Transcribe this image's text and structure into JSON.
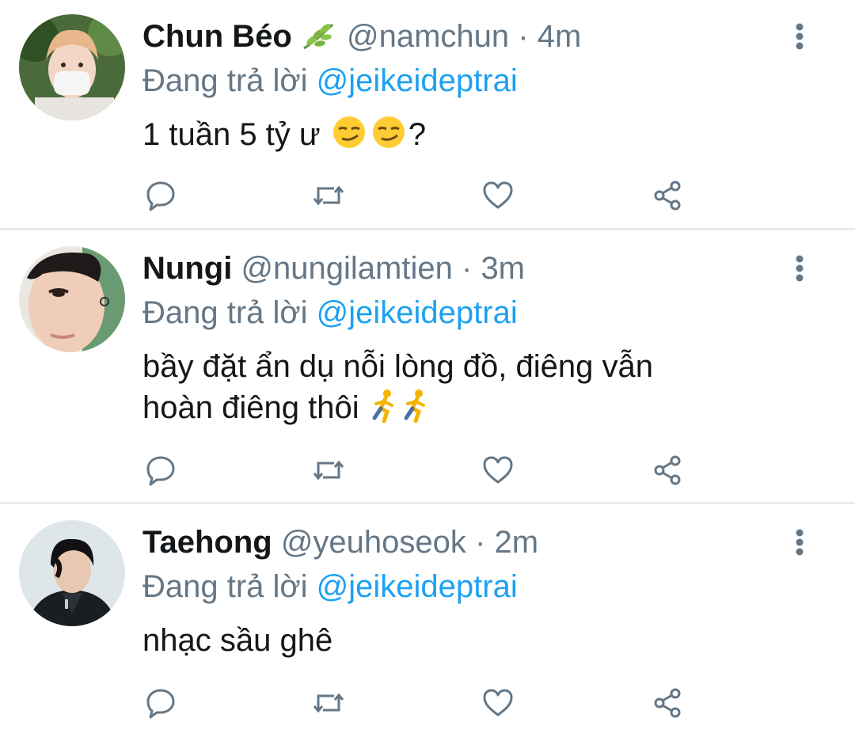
{
  "colors": {
    "text": "#14171a",
    "secondary": "#657786",
    "link": "#1da1f2",
    "divider": "#e6ecf0",
    "icon": "#657786"
  },
  "tweets": [
    {
      "name": "Chun Béo",
      "name_badge_icon": "leaf-icon",
      "handle": "@namchun",
      "time": "4m",
      "reply_prefix": "Đang trả lời",
      "reply_to": "@jeikeideptrai",
      "text_before_emoji": "1 tuần 5 tỷ ư",
      "emoji_icon": "smirking-face-icon",
      "emoji_count": 2,
      "text_after_emoji": "?"
    },
    {
      "name": "Nungi",
      "handle": "@nungilamtien",
      "time": "3m",
      "reply_prefix": "Đang trả lời",
      "reply_to": "@jeikeideptrai",
      "text_line1": "bầy đặt ẩn dụ nỗi lòng đồ, điêng vẫn",
      "text_line2": "hoàn điêng thôi",
      "emoji_icon": "running-person-icon",
      "emoji_count": 2
    },
    {
      "name": "Taehong",
      "handle": "@yeuhoseok",
      "time": "2m",
      "reply_prefix": "Đang trả lời",
      "reply_to": "@jeikeideptrai",
      "text": "nhạc sầu ghê"
    }
  ],
  "separator": "·",
  "action_icons": [
    "reply-icon",
    "retweet-icon",
    "like-icon",
    "share-icon"
  ]
}
